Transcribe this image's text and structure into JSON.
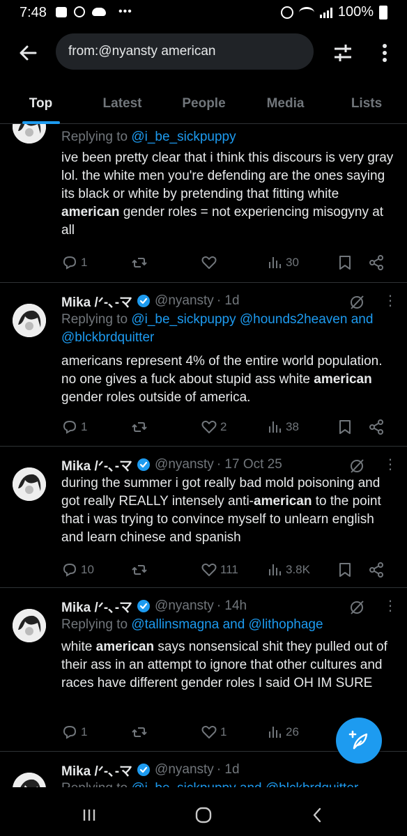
{
  "status_bar": {
    "time": "7:48",
    "battery": "100%"
  },
  "search": {
    "query": "from:@nyansty american"
  },
  "tabs": [
    {
      "label": "Top",
      "active": true
    },
    {
      "label": "Latest",
      "active": false
    },
    {
      "label": "People",
      "active": false
    },
    {
      "label": "Media",
      "active": false
    },
    {
      "label": "Lists",
      "active": false
    }
  ],
  "tweets": [
    {
      "partial": true,
      "reply_prefix": "Replying to ",
      "reply_to": "@i_be_sickpuppy",
      "text_parts": [
        "ive been pretty clear that i think this discours is very gray lol. the white men you're defending are the ones saying its black or white by pretending that fitting white ",
        "american",
        " gender roles = not experiencing misogyny at all"
      ],
      "replies": "1",
      "reposts": "",
      "likes": "",
      "views": "30"
    },
    {
      "name": "Mika /ᐟ-､-マ",
      "handle": "@nyansty",
      "time": "· 1d",
      "reply_prefix": "Replying to ",
      "reply_to": "@i_be_sickpuppy @hounds2heaven and @blckbrdquitter",
      "text_parts": [
        "americans represent 4% of the entire world population. no one gives a fuck about stupid ass white ",
        "american",
        " gender roles outside of america."
      ],
      "replies": "1",
      "reposts": "",
      "likes": "2",
      "views": "38"
    },
    {
      "name": "Mika /ᐟ-､-マ",
      "handle": "@nyansty",
      "time": "· 17 Oct 25",
      "reply_prefix": "",
      "reply_to": "",
      "text_parts": [
        "during the summer i got really bad mold poisoning and got really REALLY intensely anti-",
        "american",
        " to the point that i was trying to convince myself to unlearn english and learn chinese and spanish"
      ],
      "replies": "10",
      "reposts": "",
      "likes": "111",
      "views": "3.8K"
    },
    {
      "name": "Mika /ᐟ-､-マ",
      "handle": "@nyansty",
      "time": "· 14h",
      "reply_prefix": "Replying to ",
      "reply_to": "@tallinsmagna and @lithophage",
      "text_parts": [
        "white ",
        "american",
        " says nonsensical shit they pulled out of their ass in an attempt to ignore that other cultures and races have different gender roles I said OH IM SURE"
      ],
      "replies": "1",
      "reposts": "",
      "likes": "1",
      "views": "26"
    },
    {
      "name": "Mika /ᐟ-､-マ",
      "handle": "@nyansty",
      "time": "· 1d",
      "reply_prefix": "Replying to ",
      "reply_to": "@i_be_sickpuppy and @blckbrdquitter",
      "text_parts": [
        "",
        "",
        ""
      ]
    }
  ],
  "colors": {
    "accent": "#1d9bf0",
    "muted": "#71767b",
    "text": "#e7e9ea",
    "divider": "#2f3336",
    "background": "#000000"
  },
  "icons": [
    "back-arrow-icon",
    "filter-sliders-icon",
    "more-vertical-icon",
    "reply-icon",
    "repost-icon",
    "like-icon",
    "views-icon",
    "bookmark-icon",
    "share-icon",
    "grok-icon",
    "verified-icon",
    "compose-icon"
  ]
}
